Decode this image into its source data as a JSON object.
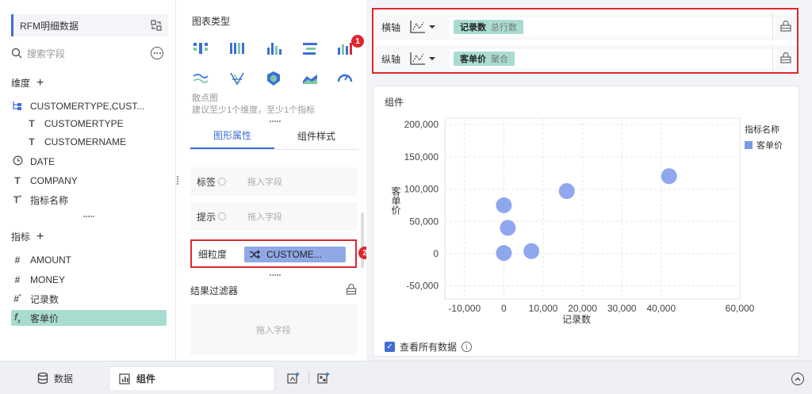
{
  "left_panel": {
    "dataset_title": "RFM明细数据",
    "search_placeholder": "搜索字段",
    "dimensions_label": "维度",
    "dimensions": [
      {
        "icon": "hierarchy-icon",
        "label": "CUSTOMERTYPE,CUST..."
      },
      {
        "icon": "text-type-icon",
        "label": "CUSTOMERTYPE"
      },
      {
        "icon": "text-type-icon",
        "label": "CUSTOMERNAME"
      },
      {
        "icon": "date-type-icon",
        "label": "DATE"
      },
      {
        "icon": "text-type-icon",
        "label": "COMPANY"
      },
      {
        "icon": "text-star-type-icon",
        "label": "指标名称"
      }
    ],
    "metrics_label": "指标",
    "metrics": [
      {
        "icon": "number-type-icon",
        "label": "AMOUNT"
      },
      {
        "icon": "number-type-icon",
        "label": "MONEY"
      },
      {
        "icon": "number-star-type-icon",
        "label": "记录数"
      },
      {
        "icon": "formula-type-icon",
        "label": "客单价"
      }
    ]
  },
  "middle_panel": {
    "chart_type_label": "图表类型",
    "chart_type_name": "散点图",
    "chart_type_hint": "建议至少1个维度，至少1个指标",
    "tabs": [
      "图形属性",
      "组件样式"
    ],
    "props": {
      "label_name": "标签",
      "label_placeholder": "拖入字段",
      "tooltip_name": "提示",
      "tooltip_placeholder": "拖入字段",
      "granularity_name": "细粒度",
      "granularity_value": "CUSTOME..."
    },
    "filter_title": "结果过滤器",
    "filter_placeholder": "拖入字段",
    "badge_1": "1",
    "badge_2": "2"
  },
  "axes": {
    "x_label": "横轴",
    "x_field": "记录数",
    "x_agg": "总行数",
    "y_label": "纵轴",
    "y_field": "客单价",
    "y_agg": "聚合"
  },
  "chart_card": {
    "title": "组件",
    "view_all_label": "查看所有数据",
    "legend_title": "指标名称",
    "legend_item": "客单价"
  },
  "chart_data": {
    "type": "scatter",
    "xlabel": "记录数",
    "ylabel": "客单价",
    "xlim": [
      -15000,
      60000
    ],
    "ylim": [
      -70000,
      210000
    ],
    "x_ticks": [
      -10000,
      0,
      10000,
      20000,
      30000,
      40000,
      60000
    ],
    "x_tick_labels": [
      "-10,000",
      "0",
      "10,000",
      "20,000",
      "30,000",
      "40,000",
      "60,000"
    ],
    "y_ticks": [
      -50000,
      0,
      50000,
      100000,
      150000,
      200000
    ],
    "y_tick_labels": [
      "-50,000",
      "0",
      "50,000",
      "100,000",
      "150,000",
      "200,000"
    ],
    "series": [
      {
        "name": "客单价",
        "color": "#7b99ea",
        "points": [
          [
            0,
            75000
          ],
          [
            1000,
            40000
          ],
          [
            0,
            1000
          ],
          [
            7000,
            4000
          ],
          [
            16000,
            97000
          ],
          [
            42000,
            120000
          ]
        ]
      }
    ]
  },
  "bottom_bar": {
    "data_tab": "数据",
    "component_tab": "组件"
  },
  "colors": {
    "accent": "#3d6fd6",
    "dim_pill": "#a8dcd0",
    "point": "#7b99ea",
    "highlight": "#e0262c"
  }
}
